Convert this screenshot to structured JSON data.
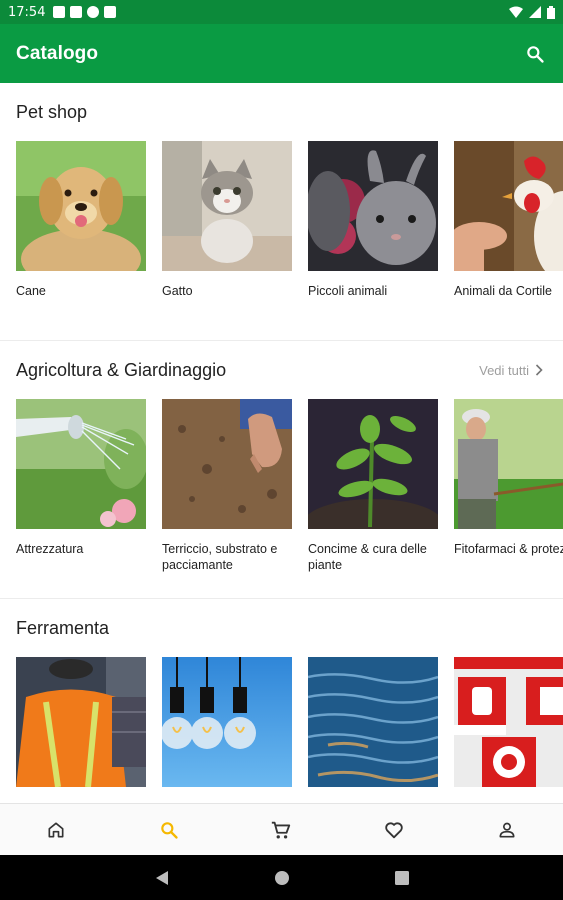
{
  "status_bar": {
    "time": "17:54"
  },
  "app_bar": {
    "title": "Catalogo",
    "search_icon": "search-icon"
  },
  "sections": [
    {
      "title": "Pet shop",
      "see_all": "",
      "items": [
        {
          "label": "Cane"
        },
        {
          "label": "Gatto"
        },
        {
          "label": "Piccoli animali"
        },
        {
          "label": "Animali da Cortile"
        }
      ]
    },
    {
      "title": "Agricoltura & Giardinaggio",
      "see_all": "Vedi tutti",
      "items": [
        {
          "label": "Attrezzatura"
        },
        {
          "label": "Terriccio, substrato e pacciamante"
        },
        {
          "label": "Concime & cura delle piante"
        },
        {
          "label": "Fitofarmaci & protezione piante"
        }
      ]
    },
    {
      "title": "Ferramenta",
      "see_all": "",
      "items": [
        {
          "label": ""
        },
        {
          "label": ""
        },
        {
          "label": ""
        },
        {
          "label": ""
        }
      ]
    }
  ],
  "bottom_nav": [
    {
      "name": "home",
      "icon": "home-icon",
      "active": false
    },
    {
      "name": "search",
      "icon": "search-icon",
      "active": true
    },
    {
      "name": "cart",
      "icon": "cart-icon",
      "active": false
    },
    {
      "name": "favorites",
      "icon": "heart-icon",
      "active": false
    },
    {
      "name": "profile",
      "icon": "person-icon",
      "active": false
    }
  ],
  "colors": {
    "status_bar": "#0c8a3a",
    "app_bar": "#0a9b43",
    "nav_active": "#f5b800",
    "nav_inactive": "#333333"
  }
}
